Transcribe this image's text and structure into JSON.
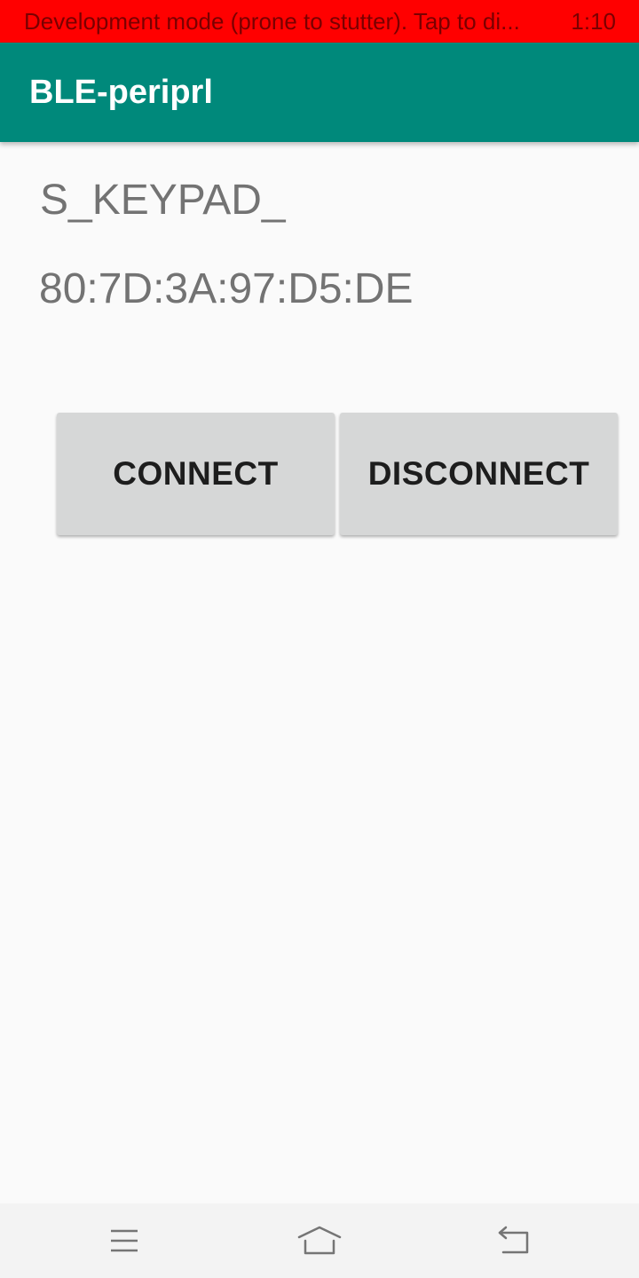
{
  "status_bar": {
    "message": "Development mode (prone to stutter). Tap to di...",
    "time": "1:10",
    "background_color": "#ff0000"
  },
  "app_bar": {
    "title": "BLE-periprl",
    "background_color": "#00897b"
  },
  "device": {
    "name": "S_KEYPAD_",
    "address": "80:7D:3A:97:D5:DE"
  },
  "buttons": {
    "connect_label": "CONNECT",
    "disconnect_label": "DISCONNECT"
  },
  "nav_bar": {
    "icons": [
      "menu-icon",
      "home-icon",
      "back-icon"
    ]
  }
}
